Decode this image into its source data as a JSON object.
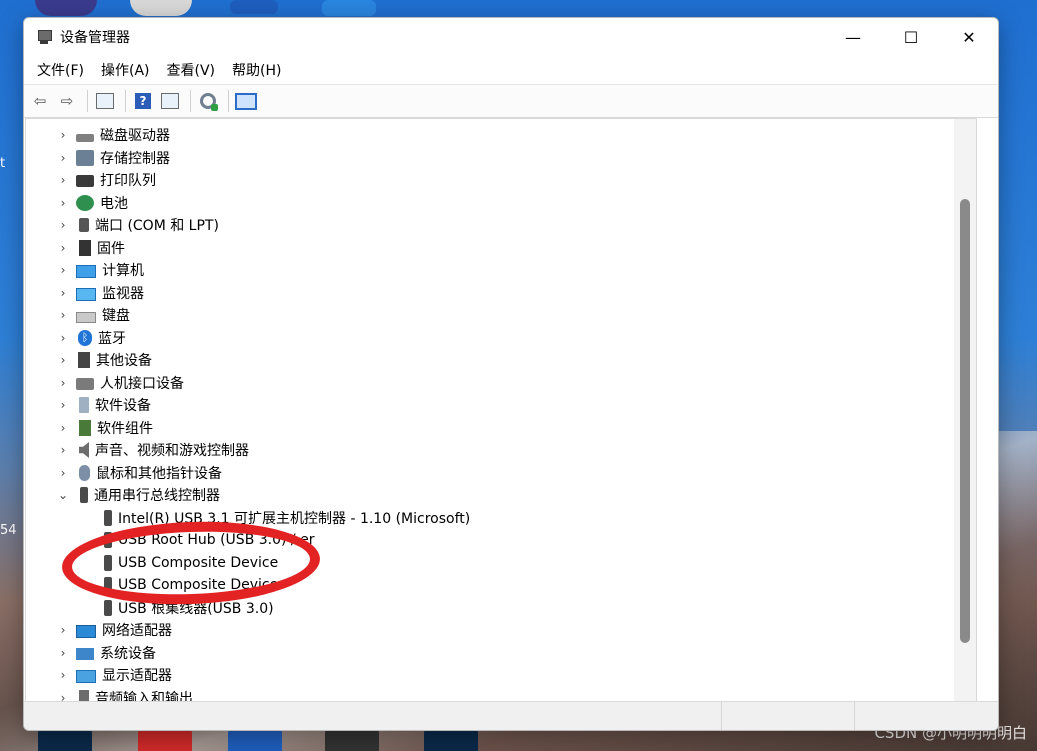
{
  "window": {
    "title": "设备管理器",
    "controls": {
      "minimize": "—",
      "maximize": "☐",
      "close": "✕"
    }
  },
  "menu": [
    "文件(F)",
    "操作(A)",
    "查看(V)",
    "帮助(H)"
  ],
  "toolbar": {
    "back_icon": "back-arrow-icon",
    "forward_icon": "forward-arrow-icon",
    "help_glyph": "?"
  },
  "tree": [
    {
      "label": "磁盘驱动器",
      "expanded": false,
      "icon": "disk-drive-icon"
    },
    {
      "label": "存储控制器",
      "expanded": false,
      "icon": "storage-controller-icon"
    },
    {
      "label": "打印队列",
      "expanded": false,
      "icon": "printer-icon"
    },
    {
      "label": "电池",
      "expanded": false,
      "icon": "battery-icon"
    },
    {
      "label": "端口 (COM 和 LPT)",
      "expanded": false,
      "icon": "port-icon"
    },
    {
      "label": "固件",
      "expanded": false,
      "icon": "firmware-icon"
    },
    {
      "label": "计算机",
      "expanded": false,
      "icon": "computer-icon"
    },
    {
      "label": "监视器",
      "expanded": false,
      "icon": "monitor-icon"
    },
    {
      "label": "键盘",
      "expanded": false,
      "icon": "keyboard-icon"
    },
    {
      "label": "蓝牙",
      "expanded": false,
      "icon": "bluetooth-icon"
    },
    {
      "label": "其他设备",
      "expanded": false,
      "icon": "other-devices-icon"
    },
    {
      "label": "人机接口设备",
      "expanded": false,
      "icon": "hid-icon"
    },
    {
      "label": "软件设备",
      "expanded": false,
      "icon": "software-device-icon"
    },
    {
      "label": "软件组件",
      "expanded": false,
      "icon": "software-component-icon"
    },
    {
      "label": "声音、视频和游戏控制器",
      "expanded": false,
      "icon": "sound-icon"
    },
    {
      "label": "鼠标和其他指针设备",
      "expanded": false,
      "icon": "mouse-icon"
    },
    {
      "label": "通用串行总线控制器",
      "expanded": true,
      "icon": "usb-controller-icon",
      "children": [
        "Intel(R) USB 3.1 可扩展主机控制器 - 1.10 (Microsoft)",
        "USB Root Hub (USB 3.0) / er",
        "USB Composite Device",
        "USB Composite Device",
        "USB 根集线器(USB 3.0)"
      ]
    },
    {
      "label": "网络适配器",
      "expanded": false,
      "icon": "network-adapter-icon"
    },
    {
      "label": "系统设备",
      "expanded": false,
      "icon": "system-device-icon"
    },
    {
      "label": "显示适配器",
      "expanded": false,
      "icon": "display-adapter-icon"
    },
    {
      "label": "音频输入和输出",
      "expanded": false,
      "icon": "audio-io-icon"
    }
  ],
  "highlight_color": "#e32323",
  "desktop": {
    "watermark": "CSDN @小明明明明白",
    "left_fragments": [
      "t",
      "54"
    ]
  }
}
